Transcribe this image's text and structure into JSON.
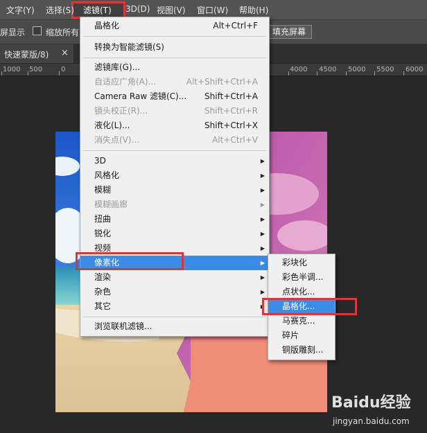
{
  "menubar": {
    "items": [
      {
        "label": "文字(Y)"
      },
      {
        "label": "选择(S)"
      },
      {
        "label": "滤镜(T)"
      },
      {
        "label": "3D(D)"
      },
      {
        "label": "视图(V)"
      },
      {
        "label": "窗口(W)"
      },
      {
        "label": "帮助(H)"
      }
    ]
  },
  "options_bar": {
    "show_label": "屏显示",
    "zoom_all_label": "缩放所有窗口",
    "fill_screen_button": "填充屏幕"
  },
  "tab": {
    "label": "快速蒙版/8)",
    "close": "×"
  },
  "ruler": {
    "labels": [
      "1000",
      "500",
      "0",
      "4000",
      "4500",
      "5000",
      "5500",
      "6000"
    ]
  },
  "filter_menu": {
    "items": [
      {
        "label": "晶格化",
        "shortcut": "Alt+Ctrl+F",
        "disabled": false
      },
      {
        "label": "转换为智能滤镜(S)",
        "shortcut": "",
        "disabled": false
      },
      {
        "label": "滤镜库(G)...",
        "shortcut": "",
        "disabled": false
      },
      {
        "label": "自适应广角(A)...",
        "shortcut": "Alt+Shift+Ctrl+A",
        "disabled": true
      },
      {
        "label": "Camera Raw 滤镜(C)...",
        "shortcut": "Shift+Ctrl+A",
        "disabled": false
      },
      {
        "label": "镜头校正(R)...",
        "shortcut": "Shift+Ctrl+R",
        "disabled": true
      },
      {
        "label": "液化(L)...",
        "shortcut": "Shift+Ctrl+X",
        "disabled": false
      },
      {
        "label": "消失点(V)...",
        "shortcut": "Alt+Ctrl+V",
        "disabled": true
      },
      {
        "label": "3D",
        "disabled": false
      },
      {
        "label": "风格化",
        "disabled": false
      },
      {
        "label": "模糊",
        "disabled": false
      },
      {
        "label": "模糊画廊",
        "disabled": true
      },
      {
        "label": "扭曲",
        "disabled": false
      },
      {
        "label": "锐化",
        "disabled": false
      },
      {
        "label": "视频",
        "disabled": false
      },
      {
        "label": "像素化",
        "disabled": false,
        "highlighted": true
      },
      {
        "label": "渲染",
        "disabled": false
      },
      {
        "label": "杂色",
        "disabled": false
      },
      {
        "label": "其它",
        "disabled": false
      },
      {
        "label": "浏览联机滤镜...",
        "disabled": false
      }
    ]
  },
  "pixelate_submenu": {
    "items": [
      {
        "label": "彩块化"
      },
      {
        "label": "彩色半调..."
      },
      {
        "label": "点状化..."
      },
      {
        "label": "晶格化...",
        "highlighted": true
      },
      {
        "label": "马赛克..."
      },
      {
        "label": "碎片"
      },
      {
        "label": "铜版雕刻..."
      }
    ]
  },
  "watermark": {
    "brand": "Baidu经验",
    "url": "jingyan.baidu.com"
  },
  "colors": {
    "accent": "#3c8ce7",
    "annotation_red": "#d9383a",
    "menu_bg": "#f0f0f0"
  }
}
